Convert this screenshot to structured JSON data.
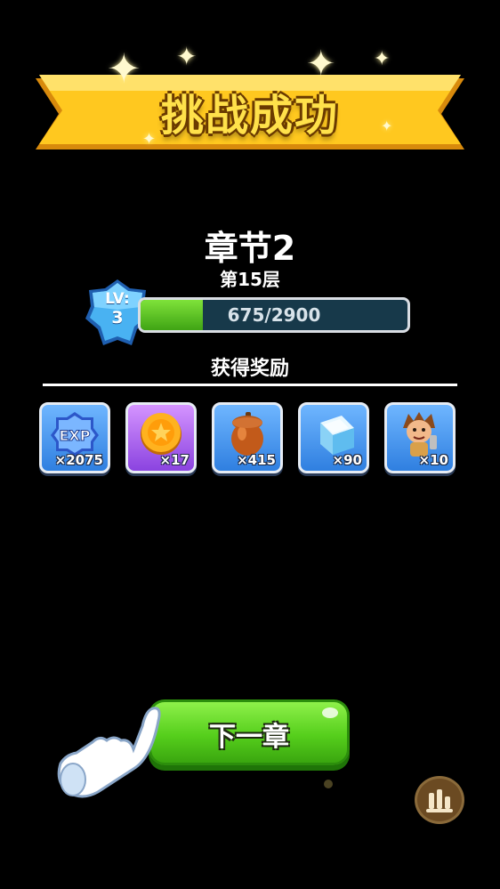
{
  "banner": {
    "title": "挑战成功"
  },
  "chapter": {
    "title": "章节2",
    "floor": "第15层"
  },
  "level": {
    "prefix": "LV:",
    "value": "3"
  },
  "exp": {
    "current": 675,
    "max": 2900,
    "text": "675/2900",
    "progress": 0.233
  },
  "rewards": {
    "title": "获得奖励",
    "items": [
      {
        "icon": "exp-icon",
        "qty": "×2075",
        "bg": "#3f8ff0"
      },
      {
        "icon": "gold-coin-icon",
        "qty": "×17",
        "bg": "#a85aea"
      },
      {
        "icon": "acorn-icon",
        "qty": "×415",
        "bg": "#3f8ff0"
      },
      {
        "icon": "ice-cube-icon",
        "qty": "×90",
        "bg": "#3f8ff0"
      },
      {
        "icon": "caveman-character-icon",
        "qty": "×10",
        "bg": "#3f8ff0"
      }
    ]
  },
  "buttons": {
    "next": "下一章"
  },
  "colors": {
    "banner": "#f7bc1c",
    "progress_fill": "#5fcb22",
    "button": "#56cf1c"
  }
}
